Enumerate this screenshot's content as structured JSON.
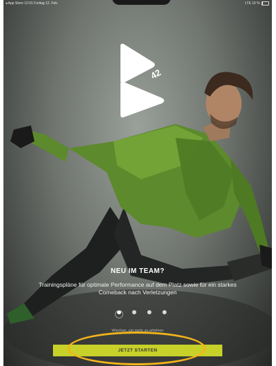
{
  "statusbar": {
    "left": "◂ App Store  12:01  Freitag 12. Feb.",
    "right": "LTE 16 %"
  },
  "logo": {
    "number": "42"
  },
  "onboarding": {
    "headline": "NEU IM TEAM?",
    "subtitle": "Trainingspläne für optimale Performance auf dem Platz sowie für ein starkes Comeback nach Verletzungen",
    "page_indicator": {
      "total": 4,
      "current": 1
    },
    "secondary_text": "Wischen, um mehr zu erfahren",
    "cta_label": "JETZT STARTEN"
  },
  "colors": {
    "accent": "#c7d12a",
    "highlight_ring": "#f2b51a"
  }
}
